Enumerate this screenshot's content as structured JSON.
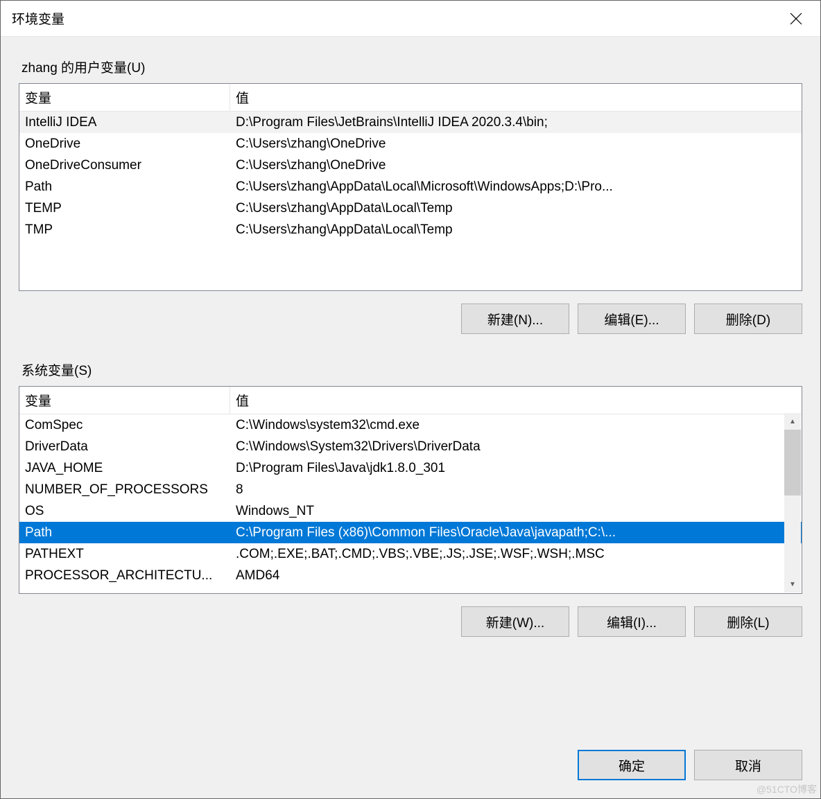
{
  "dialog": {
    "title": "环境变量"
  },
  "user_section": {
    "label": "zhang 的用户变量(U)",
    "headers": {
      "var": "变量",
      "val": "值"
    },
    "rows": [
      {
        "var": "IntelliJ IDEA",
        "val": "D:\\Program Files\\JetBrains\\IntelliJ IDEA 2020.3.4\\bin;",
        "highlight": true
      },
      {
        "var": "OneDrive",
        "val": "C:\\Users\\zhang\\OneDrive"
      },
      {
        "var": "OneDriveConsumer",
        "val": "C:\\Users\\zhang\\OneDrive"
      },
      {
        "var": "Path",
        "val": "C:\\Users\\zhang\\AppData\\Local\\Microsoft\\WindowsApps;D:\\Pro..."
      },
      {
        "var": "TEMP",
        "val": "C:\\Users\\zhang\\AppData\\Local\\Temp"
      },
      {
        "var": "TMP",
        "val": "C:\\Users\\zhang\\AppData\\Local\\Temp"
      }
    ],
    "buttons": {
      "new": "新建(N)...",
      "edit": "编辑(E)...",
      "delete": "删除(D)"
    }
  },
  "system_section": {
    "label": "系统变量(S)",
    "headers": {
      "var": "变量",
      "val": "值"
    },
    "rows": [
      {
        "var": "ComSpec",
        "val": "C:\\Windows\\system32\\cmd.exe"
      },
      {
        "var": "DriverData",
        "val": "C:\\Windows\\System32\\Drivers\\DriverData"
      },
      {
        "var": "JAVA_HOME",
        "val": "D:\\Program Files\\Java\\jdk1.8.0_301"
      },
      {
        "var": "NUMBER_OF_PROCESSORS",
        "val": "8"
      },
      {
        "var": "OS",
        "val": "Windows_NT"
      },
      {
        "var": "Path",
        "val": "C:\\Program Files (x86)\\Common Files\\Oracle\\Java\\javapath;C:\\...",
        "selected": true
      },
      {
        "var": "PATHEXT",
        "val": ".COM;.EXE;.BAT;.CMD;.VBS;.VBE;.JS;.JSE;.WSF;.WSH;.MSC"
      },
      {
        "var": "PROCESSOR_ARCHITECTU...",
        "val": "AMD64"
      }
    ],
    "buttons": {
      "new": "新建(W)...",
      "edit": "编辑(I)...",
      "delete": "删除(L)"
    }
  },
  "footer": {
    "ok": "确定",
    "cancel": "取消"
  },
  "watermark": "@51CTO博客"
}
